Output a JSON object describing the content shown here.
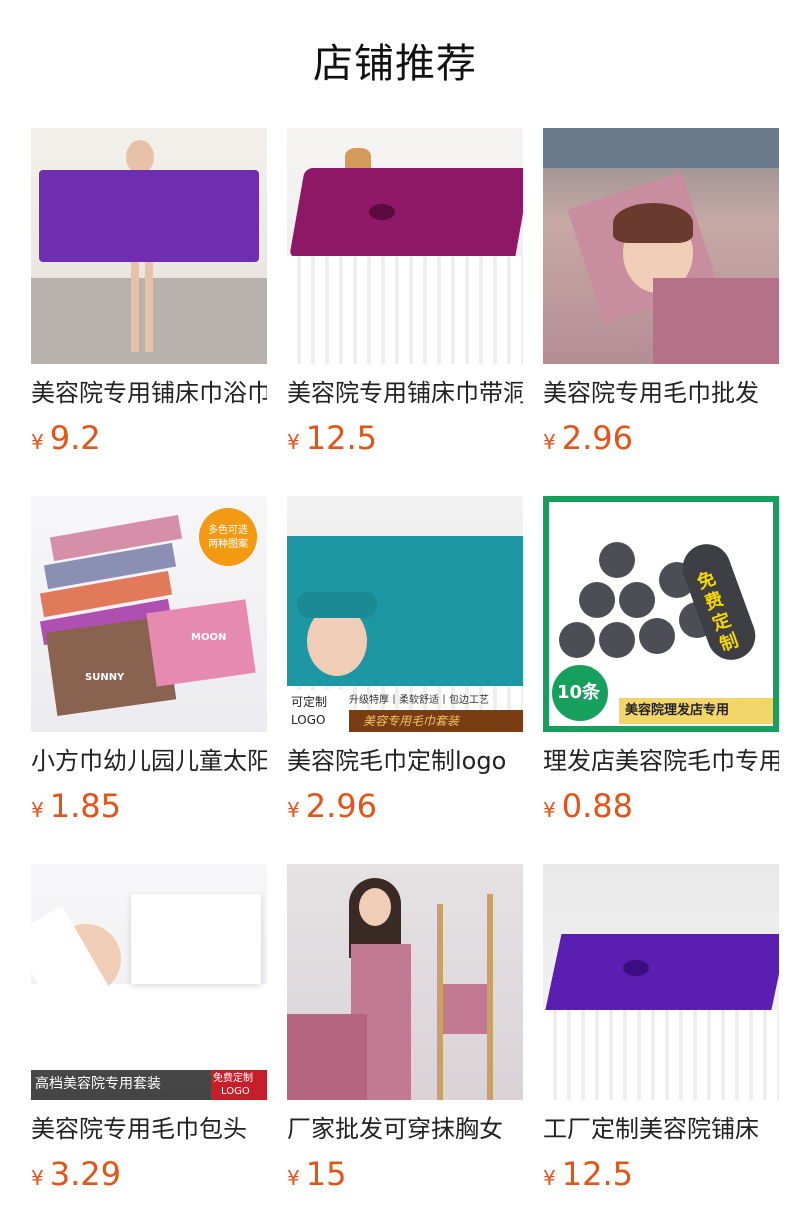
{
  "page": {
    "title": "店铺推荐"
  },
  "currency_symbol": "¥",
  "products": [
    {
      "name": "美容院专用铺床巾浴巾",
      "price": "9.2",
      "image_icon": "purple-towel-photo"
    },
    {
      "name": "美容院专用铺床巾带洞",
      "price": "12.5",
      "image_icon": "magenta-bed-cover-photo"
    },
    {
      "name": "美容院专用毛巾批发",
      "price": "2.96",
      "image_icon": "massage-towel-photo"
    },
    {
      "name": "小方巾幼儿园儿童太阳",
      "price": "1.85",
      "image_icon": "small-towels-photo",
      "image_text": [
        "多色可选",
        "两种图案",
        "SUNNY",
        "MOON"
      ]
    },
    {
      "name": "美容院毛巾定制logo",
      "price": "2.96",
      "image_icon": "teal-towel-set-photo",
      "image_text": [
        "可定制",
        "LOGO",
        "升级特厚丨柔软舒适丨包边工艺",
        "美容专用毛巾套装"
      ]
    },
    {
      "name": "理发店美容院毛巾专用",
      "price": "0.88",
      "image_icon": "rolled-towels-photo",
      "image_text": [
        "免费定制",
        "10条",
        "美容院理发店专用"
      ]
    },
    {
      "name": "美容院专用毛巾包头",
      "price": "3.29",
      "image_icon": "white-towel-set-photo",
      "image_text": [
        "高档美容院专用套装",
        "免费定制",
        "LOGO"
      ]
    },
    {
      "name": "厂家批发可穿抹胸女",
      "price": "15",
      "image_icon": "pink-bath-wrap-photo"
    },
    {
      "name": "工厂定制美容院铺床",
      "price": "12.5",
      "image_icon": "purple-bed-cover-photo"
    }
  ],
  "colors": {
    "price": "#e65316",
    "title": "#111111"
  }
}
